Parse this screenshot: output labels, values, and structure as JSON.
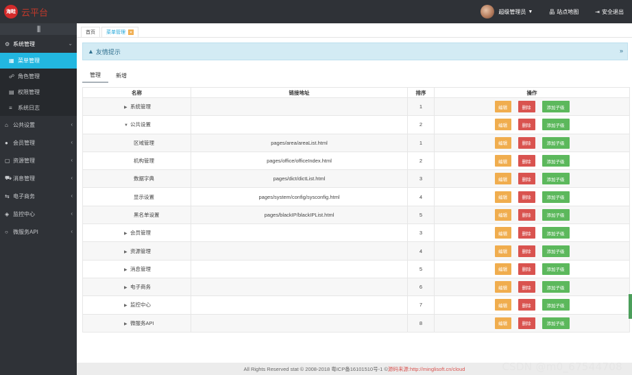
{
  "brand": {
    "badge": "海畦",
    "name": "云平台",
    "accent": "#c0392b"
  },
  "topbar": {
    "user_label": "超级管理员",
    "sitemap_label": "站点地图",
    "logout_label": "安全退出"
  },
  "sidebar": {
    "items": [
      {
        "label": "系统管理",
        "icon": "gears-icon",
        "open": true,
        "children": [
          {
            "label": "菜单管理",
            "icon": "windows-icon",
            "active": true
          },
          {
            "label": "角色管理",
            "icon": "users-icon"
          },
          {
            "label": "权限管理",
            "icon": "list-icon"
          },
          {
            "label": "系统日志",
            "icon": "lines-icon"
          }
        ]
      },
      {
        "label": "公共设置",
        "icon": "bank-icon"
      },
      {
        "label": "会员管理",
        "icon": "user-icon"
      },
      {
        "label": "资源管理",
        "icon": "doc-icon"
      },
      {
        "label": "消息管理",
        "icon": "car-icon"
      },
      {
        "label": "电子商务",
        "icon": "shop-icon"
      },
      {
        "label": "监控中心",
        "icon": "monitor-icon"
      },
      {
        "label": "微服务API",
        "icon": "circle-icon"
      }
    ]
  },
  "page_tabs": [
    {
      "label": "首页"
    },
    {
      "label": "菜单管理",
      "closable": true
    }
  ],
  "notice": {
    "title": "友情提示"
  },
  "subtabs": [
    {
      "label": "管理",
      "active": true
    },
    {
      "label": "新增"
    }
  ],
  "table": {
    "headers": [
      "名称",
      "链接地址",
      "排序",
      "操作"
    ],
    "buttons": {
      "edit": "编辑",
      "delete": "删除",
      "add_child": "添加子级"
    },
    "rows": [
      {
        "name": "系统管理",
        "kind": "parent",
        "expanded": false,
        "link": "",
        "order": "1"
      },
      {
        "name": "公共设置",
        "kind": "parent",
        "expanded": true,
        "link": "",
        "order": "2"
      },
      {
        "name": "区域管理",
        "kind": "child",
        "link": "pages/area/areaList.html",
        "order": "1"
      },
      {
        "name": "机构管理",
        "kind": "child",
        "link": "pages/office/officeIndex.html",
        "order": "2"
      },
      {
        "name": "数据字典",
        "kind": "child",
        "link": "pages/dict/dictList.html",
        "order": "3"
      },
      {
        "name": "显示设置",
        "kind": "child",
        "link": "pages/system/config/sysconfig.html",
        "order": "4"
      },
      {
        "name": "黑名单设置",
        "kind": "child",
        "link": "pages/blackIP/blackIPList.html",
        "order": "5"
      },
      {
        "name": "会员管理",
        "kind": "parent",
        "expanded": false,
        "link": "",
        "order": "3"
      },
      {
        "name": "资源管理",
        "kind": "parent",
        "expanded": false,
        "link": "",
        "order": "4"
      },
      {
        "name": "消息管理",
        "kind": "parent",
        "expanded": false,
        "link": "",
        "order": "5"
      },
      {
        "name": "电子商务",
        "kind": "parent",
        "expanded": false,
        "link": "",
        "order": "6"
      },
      {
        "name": "监控中心",
        "kind": "parent",
        "expanded": false,
        "link": "",
        "order": "7"
      },
      {
        "name": "微服务API",
        "kind": "parent",
        "expanded": false,
        "link": "",
        "order": "8"
      }
    ]
  },
  "footer": {
    "text": "All Rights Reserved stat © 2008-2018 粤ICP备16101510号-1 © ",
    "source_label": "源码来源:",
    "source_url": "http://minglisoft.cn/cloud"
  },
  "watermark": "CSDN @m0_67544708",
  "colors": {
    "sidebar": "#2f3237",
    "active": "#22b7e0",
    "edit": "#f0ad4e",
    "delete": "#d9534f",
    "add": "#5cb85c"
  }
}
